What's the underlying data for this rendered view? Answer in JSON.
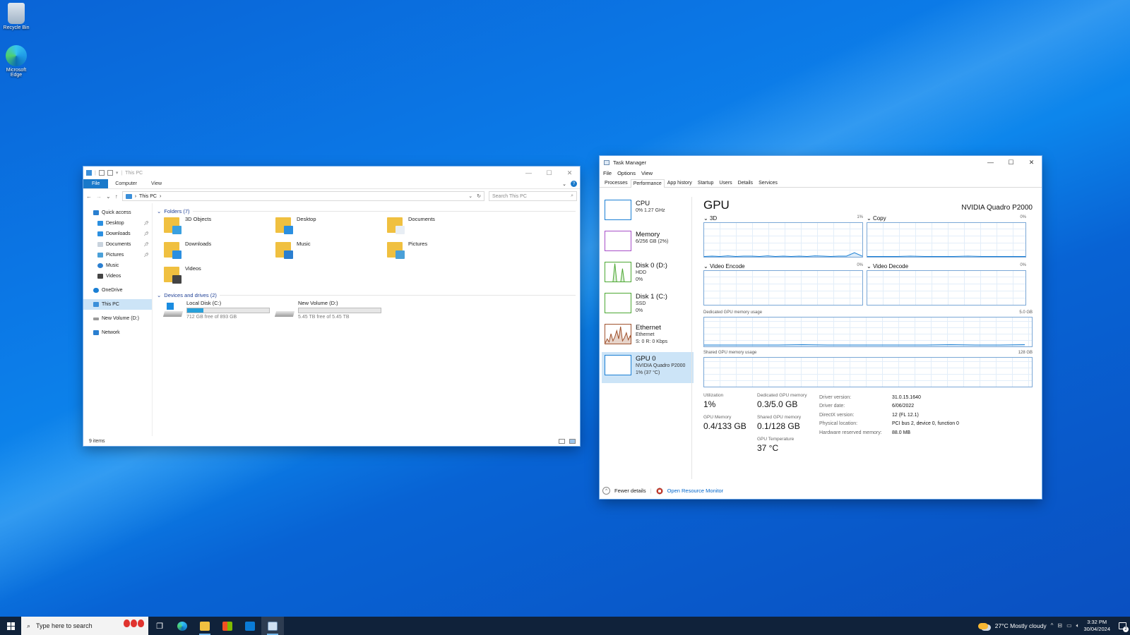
{
  "desktop": {
    "icons": [
      {
        "label": "Recycle Bin",
        "icon": "recycle-bin-icon"
      },
      {
        "label": "Microsoft Edge",
        "icon": "edge-icon"
      }
    ]
  },
  "explorer": {
    "title": "This PC",
    "ribbon_tabs": [
      "File",
      "Computer",
      "View"
    ],
    "address": {
      "current": "This PC"
    },
    "search_placeholder": "Search This PC",
    "nav": {
      "quick_access": "Quick access",
      "pinned": [
        "Desktop",
        "Downloads",
        "Documents",
        "Pictures"
      ],
      "unpinned": [
        "Music",
        "Videos"
      ],
      "onedrive": "OneDrive",
      "this_pc": "This PC",
      "new_volume": "New Volume (D:)",
      "network": "Network"
    },
    "folders_header": "Folders (7)",
    "folders": [
      {
        "name": "3D Objects",
        "badge_color": "#3aa0e0"
      },
      {
        "name": "Desktop",
        "badge_color": "#2b8fe0"
      },
      {
        "name": "Documents",
        "badge_color": "#e8eef4"
      },
      {
        "name": "Downloads",
        "badge_color": "#2b8fe0"
      },
      {
        "name": "Music",
        "badge_color": "#2b7fd0"
      },
      {
        "name": "Pictures",
        "badge_color": "#4aa0d8"
      },
      {
        "name": "Videos",
        "badge_color": "#444444"
      }
    ],
    "drives_header": "Devices and drives (2)",
    "drives": [
      {
        "name": "Local Disk (C:)",
        "free": "712 GB free of 893 GB",
        "used_fraction": 0.2
      },
      {
        "name": "New Volume (D:)",
        "free": "5.45 TB free of 5.45 TB",
        "used_fraction": 0.0
      }
    ],
    "status": "9 items"
  },
  "taskmgr": {
    "title": "Task Manager",
    "menu": [
      "File",
      "Options",
      "View"
    ],
    "tabs": [
      "Processes",
      "Performance",
      "App history",
      "Startup",
      "Users",
      "Details",
      "Services"
    ],
    "active_tab": "Performance",
    "resources": [
      {
        "name": "CPU",
        "sub1": "0% 1.27 GHz",
        "sub2": "",
        "sub3": "",
        "color": "#1a7fd4"
      },
      {
        "name": "Memory",
        "sub1": "6/256 GB (2%)",
        "sub2": "",
        "sub3": "",
        "color": "#a74ec8"
      },
      {
        "name": "Disk 0 (D:)",
        "sub1": "HDD",
        "sub2": "0%",
        "sub3": "",
        "color": "#4ca832"
      },
      {
        "name": "Disk 1 (C:)",
        "sub1": "SSD",
        "sub2": "0%",
        "sub3": "",
        "color": "#4ca832"
      },
      {
        "name": "Ethernet",
        "sub1": "Ethernet",
        "sub2": "S: 0 R: 0 Kbps",
        "sub3": "",
        "color": "#a0522d"
      },
      {
        "name": "GPU 0",
        "sub1": "NVIDIA Quadro P2000",
        "sub2": "1% (37 °C)",
        "sub3": "",
        "color": "#1a7fd4"
      }
    ],
    "gpu": {
      "heading": "GPU",
      "model": "NVIDIA Quadro P2000",
      "graphs": [
        {
          "label": "3D",
          "pct": "1%"
        },
        {
          "label": "Copy",
          "pct": "0%"
        },
        {
          "label": "Video Encode",
          "pct": "0%"
        },
        {
          "label": "Video Decode",
          "pct": "0%"
        }
      ],
      "dedicated_label": "Dedicated GPU memory usage",
      "dedicated_max": "5.0 GB",
      "shared_label": "Shared GPU memory usage",
      "shared_max": "128 GB",
      "stats": {
        "utilization_label": "Utilization",
        "utilization": "1%",
        "dedicated_mem_label": "Dedicated GPU memory",
        "dedicated_mem": "0.3/5.0 GB",
        "gpu_memory_label": "GPU Memory",
        "gpu_memory": "0.4/133 GB",
        "shared_mem_label": "Shared GPU memory",
        "shared_mem": "0.1/128 GB",
        "temp_label": "GPU Temperature",
        "temp": "37 °C"
      },
      "details": [
        {
          "k": "Driver version:",
          "v": "31.0.15.1640"
        },
        {
          "k": "Driver date:",
          "v": "6/06/2022"
        },
        {
          "k": "DirectX version:",
          "v": "12 (FL 12.1)"
        },
        {
          "k": "Physical location:",
          "v": "PCI bus 2, device 0, function 0"
        },
        {
          "k": "Hardware reserved memory:",
          "v": "88.0 MB"
        }
      ]
    },
    "footer": {
      "fewer": "Fewer details",
      "resmon": "Open Resource Monitor"
    }
  },
  "taskbar": {
    "search_placeholder": "Type here to search",
    "weather": "27°C  Mostly cloudy",
    "time": "3:32 PM",
    "date": "30/04/2024",
    "notifications": "2"
  }
}
